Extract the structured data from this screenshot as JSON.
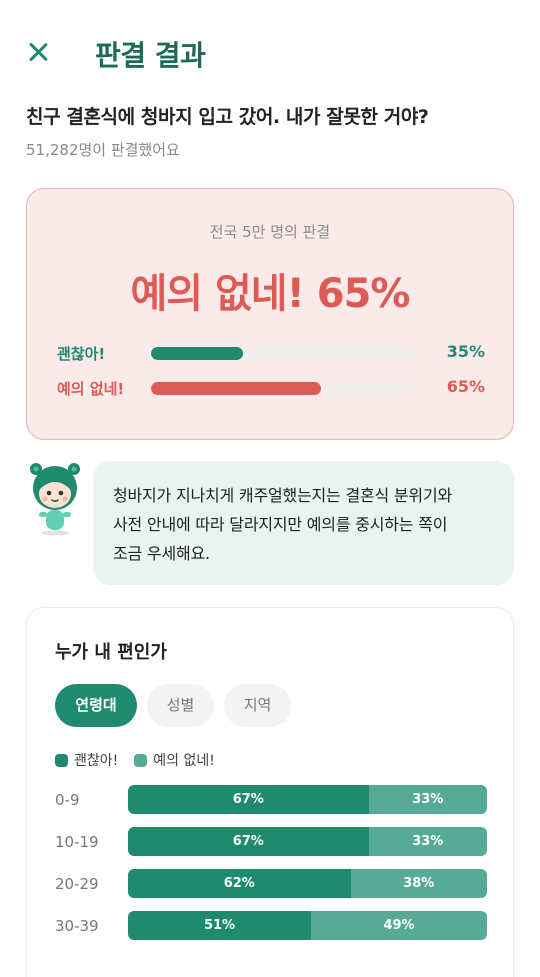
{
  "header": {
    "close_icon": "close-icon",
    "title": "판결 결과"
  },
  "question": {
    "text": "친구 결혼식에 청바지 입고 갔어. 내가 잘못한 거야?",
    "count_text": "51,282명이 판결했어요"
  },
  "verdict": {
    "caption": "전국 5만 명의 판결",
    "headline": "예의 없네! 65%",
    "options": [
      {
        "label": "괜찮아!",
        "percent": 35,
        "percent_text": "35%",
        "color": "#1f8a6e"
      },
      {
        "label": "예의 없네!",
        "percent": 65,
        "percent_text": "65%",
        "color": "#de5a55"
      }
    ]
  },
  "comment": {
    "mascot_icon": "mascot-icon",
    "lines": [
      "청바지가 지나치게 캐주얼했는지는 결혼식 분위기와",
      "사전 안내에 따라 달라지지만 예의를 중시하는 쪽이",
      "조금 우세해요."
    ]
  },
  "sides": {
    "title": "누가 내 편인가",
    "tabs": [
      {
        "label": "연령대",
        "active": true
      },
      {
        "label": "성별",
        "active": false
      },
      {
        "label": "지역",
        "active": false
      }
    ],
    "legend": [
      {
        "label": "괜찮아!",
        "color": "#1f8a6e"
      },
      {
        "label": "예의 없네!",
        "color": "#57aa96"
      }
    ],
    "rows": [
      {
        "age": "0-9",
        "ok": 67,
        "ok_text": "67%",
        "rude": 33,
        "rude_text": "33%"
      },
      {
        "age": "10-19",
        "ok": 67,
        "ok_text": "67%",
        "rude": 33,
        "rude_text": "33%"
      },
      {
        "age": "20-29",
        "ok": 62,
        "ok_text": "62%",
        "rude": 38,
        "rude_text": "38%"
      },
      {
        "age": "30-39",
        "ok": 51,
        "ok_text": "51%",
        "rude": 49,
        "rude_text": "49%"
      }
    ]
  }
}
